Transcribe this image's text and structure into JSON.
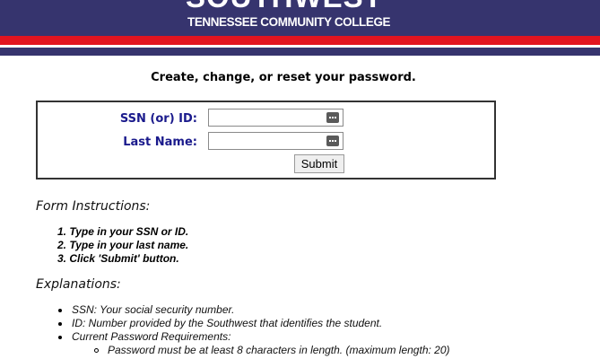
{
  "header": {
    "logo_main": "SOUTHWEST",
    "logo_sub": "TENNESSEE COMMUNITY COLLEGE"
  },
  "page": {
    "heading": "Create, change, or reset your password."
  },
  "form": {
    "ssn_label": "SSN (or) ID:",
    "ssn_value": "",
    "lastname_label": "Last Name:",
    "lastname_value": "",
    "submit_label": "Submit"
  },
  "instructions": {
    "title": "Form Instructions:",
    "steps": [
      "1. Type in your SSN or ID.",
      "2. Type in your last name.",
      "3. Click 'Submit' button."
    ]
  },
  "explanations": {
    "title": "Explanations:",
    "items": [
      "SSN: Your social security number.",
      "ID: Number provided by the Southwest that identifies the student.",
      "Current Password Requirements:"
    ],
    "sub_items": [
      "Password must be at least 8 characters in length. (maximum length: 20)"
    ]
  },
  "colors": {
    "banner": "#36346e",
    "stripe": "#e1141f",
    "label": "#1a1a8c"
  }
}
